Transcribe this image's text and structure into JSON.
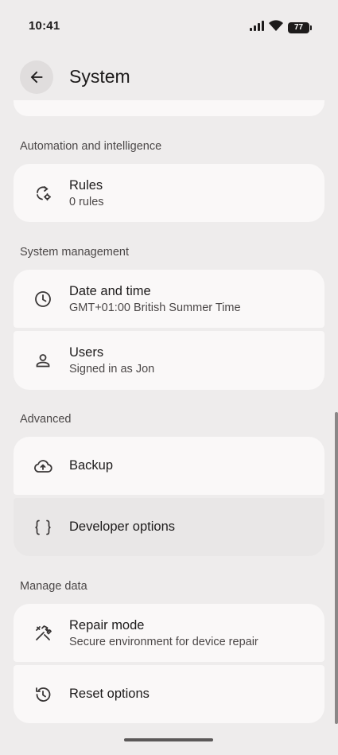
{
  "status_bar": {
    "time": "10:41",
    "battery": "77"
  },
  "header": {
    "title": "System"
  },
  "sections": [
    {
      "header": "Automation and intelligence",
      "items": [
        {
          "title": "Rules",
          "subtitle": "0 rules",
          "icon": "rules-icon"
        }
      ]
    },
    {
      "header": "System management",
      "items": [
        {
          "title": "Date and time",
          "subtitle": "GMT+01:00 British Summer Time",
          "icon": "clock-icon"
        },
        {
          "title": "Users",
          "subtitle": "Signed in as Jon",
          "icon": "person-icon"
        }
      ]
    },
    {
      "header": "Advanced",
      "items": [
        {
          "title": "Backup",
          "icon": "cloud-upload-icon"
        },
        {
          "title": "Developer options",
          "icon": "braces-icon"
        }
      ]
    },
    {
      "header": "Manage data",
      "items": [
        {
          "title": "Repair mode",
          "subtitle": "Secure environment for device repair",
          "icon": "repair-tools-icon"
        },
        {
          "title": "Reset options",
          "icon": "history-icon"
        }
      ]
    }
  ],
  "colors": {
    "background": "#eeecec",
    "card": "#faf8f8",
    "pressed": "#e9e7e7",
    "text": "#1d1b1b",
    "secondary": "#4b4747"
  }
}
